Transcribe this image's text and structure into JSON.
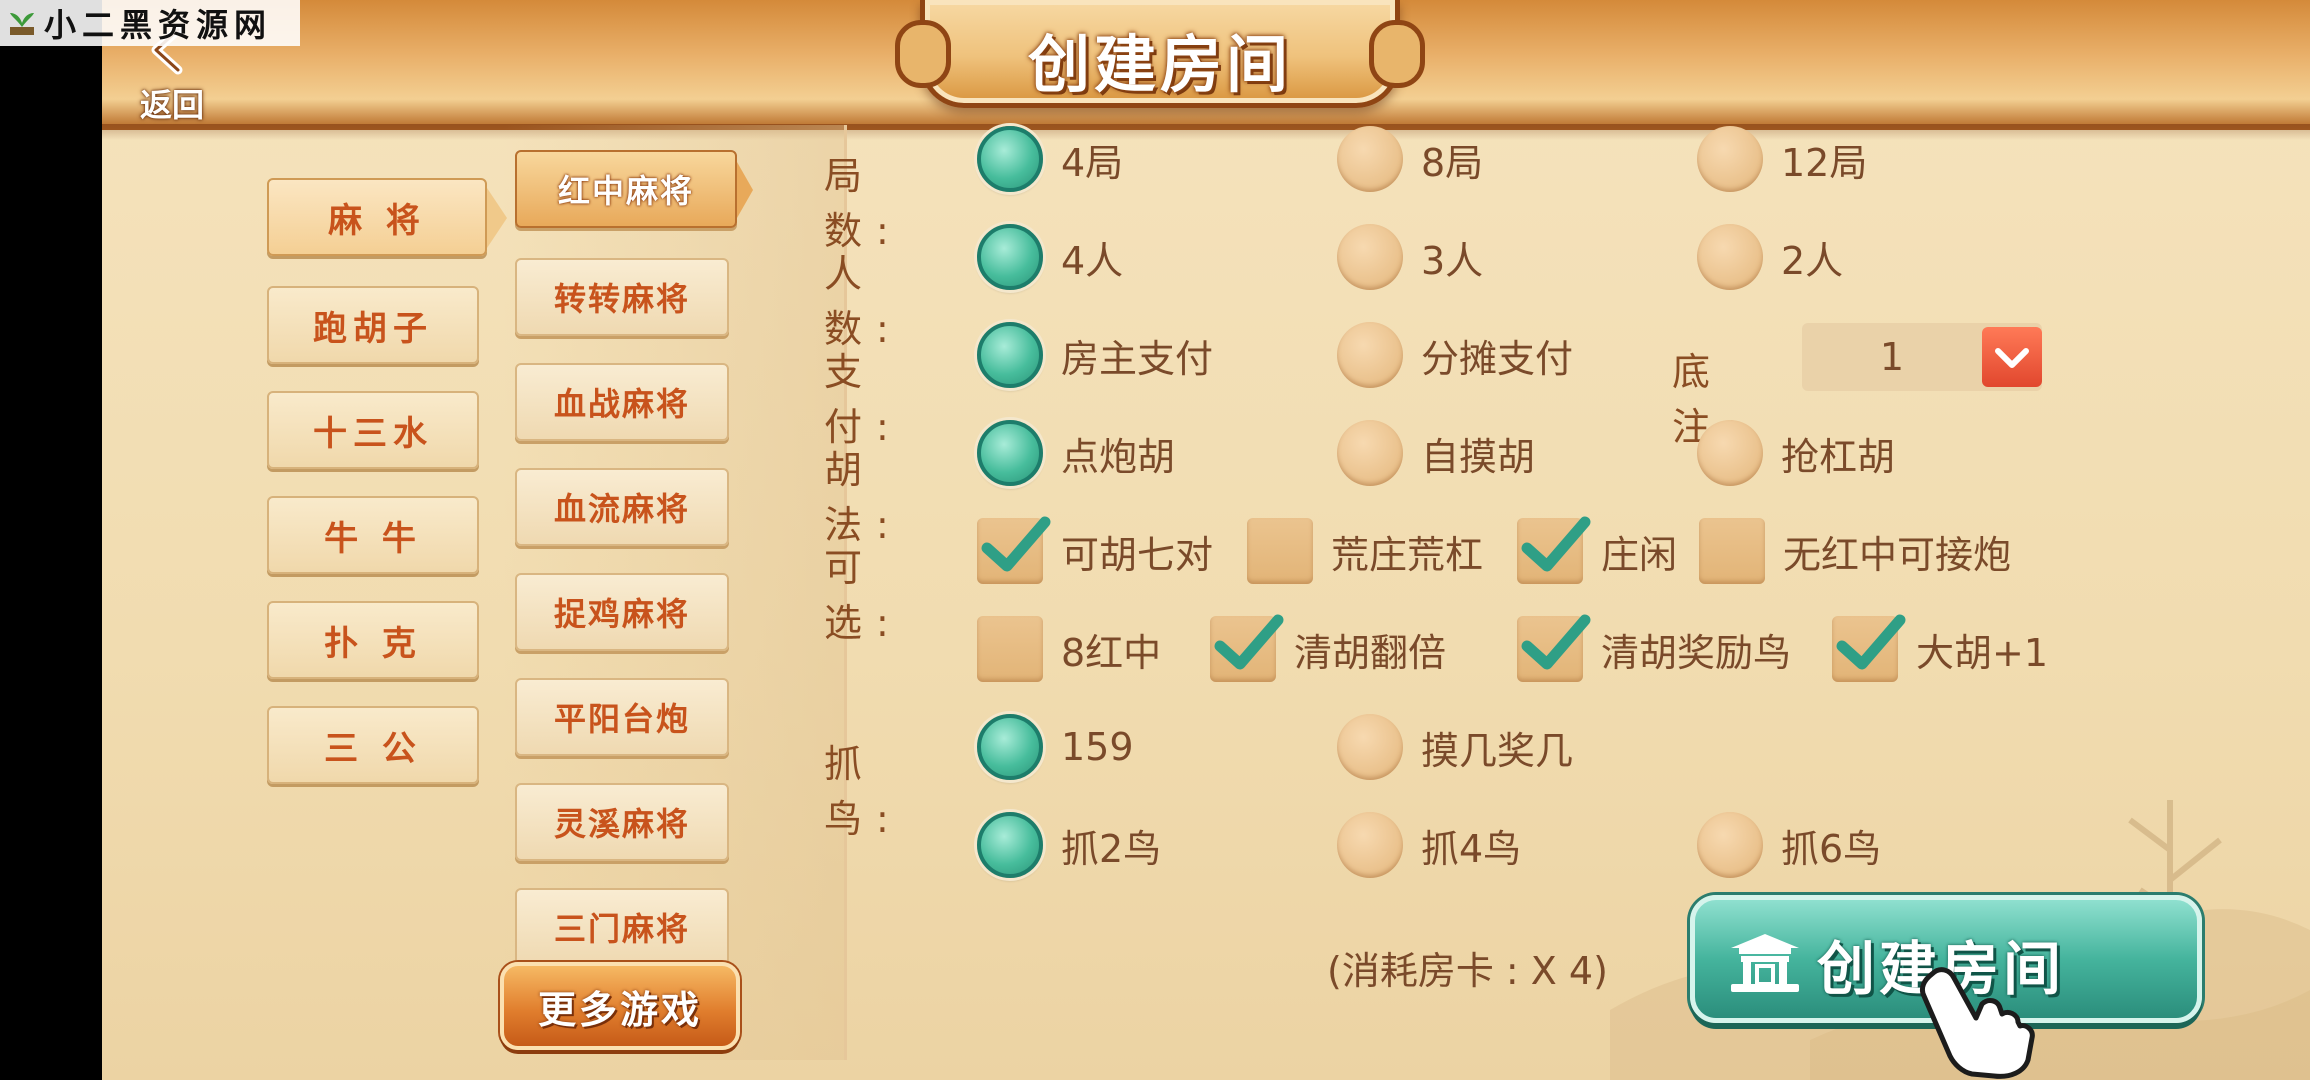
{
  "watermark": {
    "text": "小二黑资源网"
  },
  "header": {
    "back_label": "返回",
    "title": "创建房间"
  },
  "categories": [
    {
      "label": "麻 将",
      "active": true
    },
    {
      "label": "跑胡子",
      "active": false
    },
    {
      "label": "十三水",
      "active": false
    },
    {
      "label": "牛 牛",
      "active": false
    },
    {
      "label": "扑 克",
      "active": false
    },
    {
      "label": "三 公",
      "active": false
    }
  ],
  "games": [
    {
      "label": "红中麻将",
      "active": true
    },
    {
      "label": "转转麻将",
      "active": false
    },
    {
      "label": "血战麻将",
      "active": false
    },
    {
      "label": "血流麻将",
      "active": false
    },
    {
      "label": "捉鸡麻将",
      "active": false
    },
    {
      "label": "平阳台炮",
      "active": false
    },
    {
      "label": "灵溪麻将",
      "active": false
    },
    {
      "label": "三门麻将",
      "active": false
    }
  ],
  "more_games_label": "更多游戏",
  "options": {
    "rounds": {
      "label": "局 数:",
      "choices": [
        "4局",
        "8局",
        "12局"
      ],
      "selected": "4局"
    },
    "players": {
      "label": "人 数:",
      "choices": [
        "4人",
        "3人",
        "2人"
      ],
      "selected": "4人"
    },
    "payment": {
      "label": "支 付:",
      "choices": [
        "房主支付",
        "分摊支付"
      ],
      "selected": "房主支付"
    },
    "base_bet": {
      "label": "底 注:",
      "value": "1"
    },
    "win_method": {
      "label": "胡 法:",
      "choices": [
        "点炮胡",
        "自摸胡",
        "抢杠胡"
      ],
      "selected": "点炮胡"
    },
    "optional": {
      "label": "可 选:",
      "items": [
        {
          "label": "可胡七对",
          "checked": true
        },
        {
          "label": "荒庄荒杠",
          "checked": false
        },
        {
          "label": "庄闲",
          "checked": true
        },
        {
          "label": "无红中可接炮",
          "checked": false
        },
        {
          "label": "8红中",
          "checked": false
        },
        {
          "label": "清胡翻倍",
          "checked": true
        },
        {
          "label": "清胡奖励鸟",
          "checked": true
        },
        {
          "label": "大胡+1",
          "checked": true
        }
      ]
    },
    "bird": {
      "label": "抓 鸟:",
      "mode_choices": [
        "159",
        "摸几奖几"
      ],
      "mode_selected": "159",
      "count_choices": [
        "抓2鸟",
        "抓4鸟",
        "抓6鸟"
      ],
      "count_selected": "抓2鸟"
    }
  },
  "cost_text": "(消耗房卡 : X 4)",
  "create_button_label": "创建房间",
  "colors": {
    "accent_teal": "#45b49d",
    "label_brown": "#8a4d23",
    "tab_orange": "#c8531c"
  }
}
